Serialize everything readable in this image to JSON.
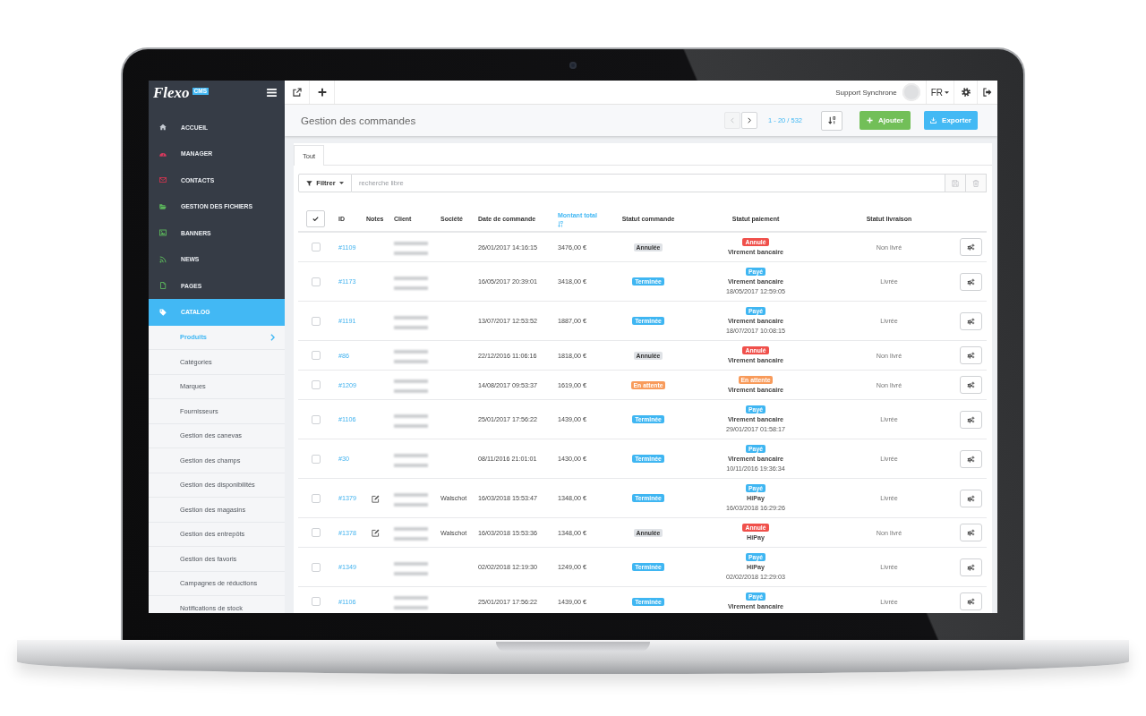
{
  "sidebar": {
    "logo": {
      "name": "Flexo",
      "badge": "CMS"
    },
    "items": [
      {
        "label": "ACCUEIL",
        "selected": false
      },
      {
        "label": "MANAGER",
        "selected": false
      },
      {
        "label": "CONTACTS",
        "selected": false
      },
      {
        "label": "GESTION DES FICHIERS",
        "selected": false
      },
      {
        "label": "BANNERS",
        "selected": false
      },
      {
        "label": "NEWS",
        "selected": false
      },
      {
        "label": "PAGES",
        "selected": false
      },
      {
        "label": "CATALOG",
        "selected": true,
        "expanded": true,
        "children": [
          {
            "label": "Produits",
            "selected": true
          },
          {
            "label": "Catégories",
            "selected": false
          },
          {
            "label": "Marques",
            "selected": false
          },
          {
            "label": "Fournisseurs",
            "selected": false
          },
          {
            "label": "Gestion des canevas",
            "selected": false
          },
          {
            "label": "Gestion des champs",
            "selected": false
          },
          {
            "label": "Gestion des disponibilités",
            "selected": false
          },
          {
            "label": "Gestion des magasins",
            "selected": false
          },
          {
            "label": "Gestion des entrepôts",
            "selected": false
          },
          {
            "label": "Gestion des favoris",
            "selected": false
          },
          {
            "label": "Campagnes de réductions",
            "selected": false
          },
          {
            "label": "Notifications de stock",
            "selected": false
          }
        ]
      }
    ]
  },
  "topbar": {
    "user": "Support Synchrone",
    "language": "FR"
  },
  "header": {
    "title": "Gestion des commandes",
    "pager": {
      "previous": {
        "disabled": true
      },
      "next": {
        "disabled": false
      },
      "range": "1 - 20 / 532"
    },
    "buttons": [
      {
        "label": "Ajouter",
        "kind": "add"
      },
      {
        "label": "Exporter",
        "kind": "export"
      }
    ]
  },
  "tabs": [
    {
      "label": "Tout",
      "selected": true
    }
  ],
  "filter": {
    "button": "Filtrer",
    "placeholder": "recherche libre"
  },
  "table": {
    "columns": [
      {
        "label": "ID",
        "sorted": false
      },
      {
        "label": "Notes",
        "sorted": false
      },
      {
        "label": "Client",
        "sorted": false
      },
      {
        "label": "Société",
        "sorted": false
      },
      {
        "label": "Date de commande",
        "sorted": false
      },
      {
        "label": "Montant total",
        "sorted": true
      },
      {
        "label": "Statut commande",
        "sorted": false
      },
      {
        "label": "Statut paiement",
        "sorted": false
      },
      {
        "label": "Statut livraison",
        "sorted": false
      }
    ],
    "rows": [
      {
        "selected": false,
        "id": "#1109",
        "has_note": false,
        "client_redacted": true,
        "date": "26/01/2017 14:16:15",
        "total": "3476,00 €",
        "order_status": {
          "label": "Annulée",
          "color": "#dfe2e6"
        },
        "payment": {
          "status": {
            "label": "Annulé",
            "color": "#f0504b"
          },
          "method": "Virement bancaire"
        },
        "delivery": "Non livré"
      },
      {
        "selected": false,
        "id": "#1173",
        "has_note": false,
        "client_redacted": true,
        "date": "16/05/2017 20:39:01",
        "total": "3418,00 €",
        "order_status": {
          "label": "Terminée",
          "color": "#3fb6f2"
        },
        "payment": {
          "status": {
            "label": "Payé",
            "color": "#3fb6f2"
          },
          "method": "Virement bancaire",
          "date": "18/05/2017 12:59:05"
        },
        "delivery": "Livrée"
      },
      {
        "selected": false,
        "id": "#1191",
        "has_note": false,
        "client_redacted": true,
        "date": "13/07/2017 12:53:52",
        "total": "1887,00 €",
        "order_status": {
          "label": "Terminée",
          "color": "#3fb6f2"
        },
        "payment": {
          "status": {
            "label": "Payé",
            "color": "#3fb6f2"
          },
          "method": "Virement bancaire",
          "date": "18/07/2017 10:08:15"
        },
        "delivery": "Livrée"
      },
      {
        "selected": false,
        "id": "#86",
        "has_note": false,
        "client_redacted": true,
        "date": "22/12/2016 11:06:16",
        "total": "1818,00 €",
        "order_status": {
          "label": "Annulée",
          "color": "#dfe2e6"
        },
        "payment": {
          "status": {
            "label": "Annulé",
            "color": "#f0504b"
          },
          "method": "Virement bancaire"
        },
        "delivery": "Non livré"
      },
      {
        "selected": false,
        "id": "#1209",
        "has_note": false,
        "client_redacted": true,
        "date": "14/08/2017 09:53:37",
        "total": "1619,00 €",
        "order_status": {
          "label": "En attente",
          "color": "#f89b5b"
        },
        "payment": {
          "status": {
            "label": "En attente",
            "color": "#f89b5b"
          },
          "method": "Virement bancaire"
        },
        "delivery": "Non livré"
      },
      {
        "selected": false,
        "id": "#1106",
        "has_note": false,
        "client_redacted": true,
        "date": "25/01/2017 17:56:22",
        "total": "1439,00 €",
        "order_status": {
          "label": "Terminée",
          "color": "#3fb6f2"
        },
        "payment": {
          "status": {
            "label": "Payé",
            "color": "#3fb6f2"
          },
          "method": "Virement bancaire",
          "date": "29/01/2017 01:58:17"
        },
        "delivery": "Livrée"
      },
      {
        "selected": false,
        "id": "#30",
        "has_note": false,
        "client_redacted": true,
        "date": "08/11/2016 21:01:01",
        "total": "1430,00 €",
        "order_status": {
          "label": "Terminée",
          "color": "#3fb6f2"
        },
        "payment": {
          "status": {
            "label": "Payé",
            "color": "#3fb6f2"
          },
          "method": "Virement bancaire",
          "date": "10/11/2016 19:36:34"
        },
        "delivery": "Livrée"
      },
      {
        "selected": false,
        "id": "#1379",
        "has_note": true,
        "client_redacted": true,
        "company": "Walschot",
        "date": "16/03/2018 15:53:47",
        "total": "1348,00 €",
        "order_status": {
          "label": "Terminée",
          "color": "#3fb6f2"
        },
        "payment": {
          "status": {
            "label": "Payé",
            "color": "#3fb6f2"
          },
          "method": "HiPay",
          "date": "16/03/2018 16:29:26"
        },
        "delivery": "Livrée"
      },
      {
        "selected": false,
        "id": "#1378",
        "has_note": true,
        "client_redacted": true,
        "company": "Walschot",
        "date": "16/03/2018 15:53:36",
        "total": "1348,00 €",
        "order_status": {
          "label": "Annulée",
          "color": "#dfe2e6"
        },
        "payment": {
          "status": {
            "label": "Annulé",
            "color": "#f0504b"
          },
          "method": "HiPay"
        },
        "delivery": "Non livré"
      },
      {
        "selected": false,
        "id": "#1349",
        "has_note": false,
        "client_redacted": true,
        "date": "02/02/2018 12:19:30",
        "total": "1249,00 €",
        "order_status": {
          "label": "Terminée",
          "color": "#3fb6f2"
        },
        "payment": {
          "status": {
            "label": "Payé",
            "color": "#3fb6f2"
          },
          "method": "HiPay",
          "date": "02/02/2018 12:29:03"
        },
        "delivery": "Livrée"
      },
      {
        "selected": false,
        "id": "#1106",
        "has_note": false,
        "client_redacted": true,
        "date": "25/01/2017 17:56:22",
        "total": "1439,00 €",
        "order_status": {
          "label": "Terminée",
          "color": "#3fb6f2"
        },
        "payment": {
          "status": {
            "label": "Payé",
            "color": "#3fb6f2"
          },
          "method": "Virement bancaire"
        },
        "delivery": "Livrée"
      }
    ]
  }
}
